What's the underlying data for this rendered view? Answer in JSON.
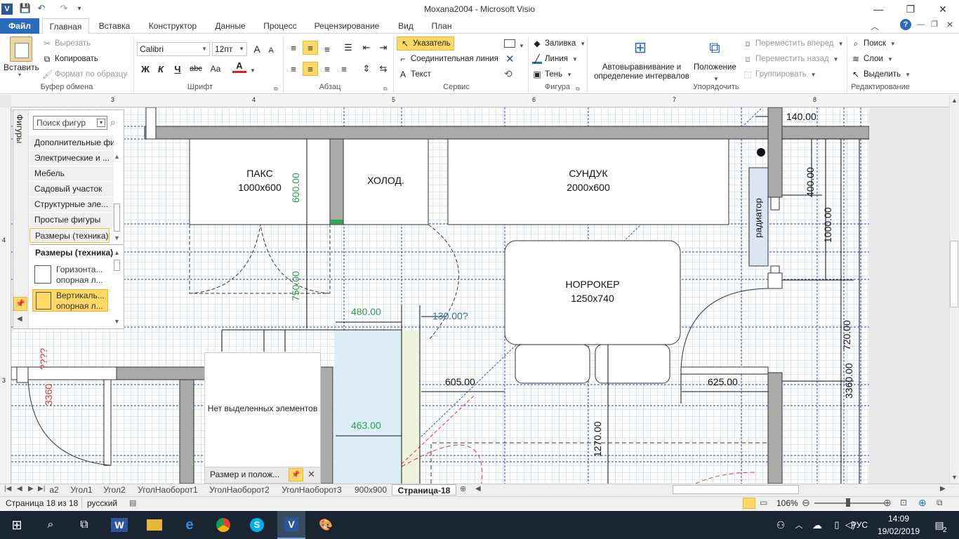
{
  "window": {
    "title": "Moxana2004 - Microsoft Visio",
    "controls": {
      "minimize": "—",
      "maximize": "❐",
      "close": "✕"
    }
  },
  "qat": {
    "app_icon": "V",
    "save_icon": "💾",
    "undo_icon": "↶",
    "redo_icon": "↷"
  },
  "tabs": [
    "Файл",
    "Главная",
    "Вставка",
    "Конструктор",
    "Данные",
    "Процесс",
    "Рецензирование",
    "Вид",
    "План"
  ],
  "ribbon": {
    "clipboard": {
      "paste": "Вставить",
      "cut": "Вырезать",
      "copy": "Копировать",
      "format_painter": "Формат по образцу",
      "label": "Буфер обмена"
    },
    "font": {
      "family": "Calibri",
      "size": "12пт",
      "bold": "Ж",
      "italic": "К",
      "underline": "Ч",
      "strike": "abc",
      "case": "Aa",
      "color": "A",
      "grow": "A",
      "shrink": "A",
      "label": "Шрифт"
    },
    "paragraph": {
      "label": "Абзац"
    },
    "tools": {
      "pointer": "Указатель",
      "connector": "Соединительная линия",
      "text": "Текст",
      "label": "Сервис"
    },
    "shape": {
      "fill": "Заливка",
      "line": "Линия",
      "shadow": "Тень",
      "label": "Фигура"
    },
    "arrange": {
      "auto_align": "Автовыравнивание и определение интервалов",
      "position": "Положение",
      "bring_forward": "Переместить вперед",
      "send_backward": "Переместить назад",
      "group": "Группировать",
      "label": "Упорядочить"
    },
    "editing": {
      "find": "Поиск",
      "layers": "Слои",
      "select": "Выделить",
      "label": "Редактирование"
    }
  },
  "ruler": {
    "h_ticks": [
      "3",
      "4",
      "5",
      "6",
      "7",
      "8"
    ],
    "v_ticks": [
      "4",
      "3"
    ]
  },
  "shapes_panel": {
    "header": "Фигуры",
    "search_placeholder": "Поиск фигур",
    "stencils": [
      "Дополнительные фи...",
      "Электрические и ...",
      "Мебель",
      "Садовый участок",
      "Структурные эле...",
      "Простые фигуры",
      "Размеры (техника)"
    ],
    "active_stencil": "Размеры (техника)",
    "masters": [
      {
        "line1": "Горизонта...",
        "line2": "опорная л..."
      },
      {
        "line1": "Вертикаль...",
        "line2": "опорная л..."
      }
    ]
  },
  "size_panel": {
    "empty_text": "Нет выделенных элементов",
    "title": "Размер и полож...",
    "close": "✕"
  },
  "drawing": {
    "paks": {
      "name": "ПАКС",
      "size": "1000x600"
    },
    "holod": {
      "name": "ХОЛОД."
    },
    "sunduk": {
      "name": "СУНДУК",
      "size": "2000x600"
    },
    "norroker": {
      "name": "НОРРОКЕР",
      "size": "1250x740"
    },
    "radiator": {
      "name": "радиатор"
    },
    "dims": {
      "d140": "140.00",
      "d400": "400.00",
      "d1000": "1000.00",
      "d600": "600.00",
      "d750": "750.00",
      "d480": "480.00",
      "d130": "130.00?",
      "d605": "605.00",
      "d625": "625.00",
      "d720": "720.00",
      "d3360a": "3360.00",
      "d463": "463.00",
      "d1270": "1270.00",
      "d3360r": "3360",
      "dq": "????"
    }
  },
  "sheet_tabs": [
    "а2",
    "Угол1",
    "Угол2",
    "УголНаоборот1",
    "УголНаоборот2",
    "УголНаоборот3",
    "900x900",
    "Страница-18"
  ],
  "active_sheet": "Страница-18",
  "status": {
    "page": "Страница 18 из 18",
    "lang": "русский",
    "zoom": "106%"
  },
  "taskbar": {
    "lang": "РУС",
    "time": "14:09",
    "date": "19/02/2019",
    "notifications": "2"
  }
}
